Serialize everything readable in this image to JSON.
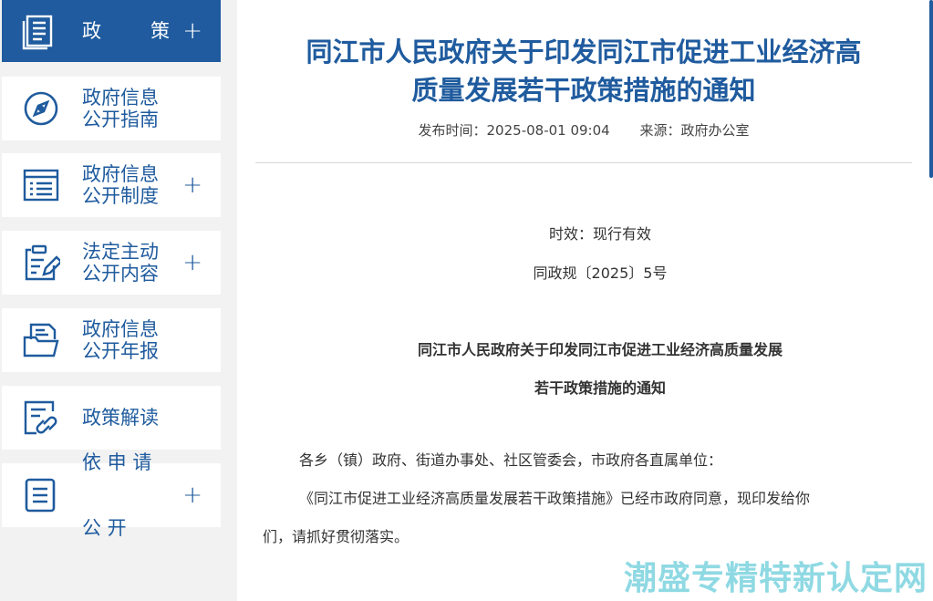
{
  "sidebar": {
    "items": [
      {
        "lines": [
          "政",
          "策"
        ],
        "plus": "+"
      },
      {
        "lines": [
          "政府信息",
          "公开指南"
        ]
      },
      {
        "lines": [
          "政府信息",
          "公开制度"
        ],
        "plus": "+"
      },
      {
        "lines": [
          "法定主动",
          "公开内容"
        ],
        "plus": "+"
      },
      {
        "lines": [
          "政府信息",
          "公开年报"
        ]
      },
      {
        "lines": [
          "政策解读"
        ]
      },
      {
        "lines": [
          "依 申 请",
          "公     开"
        ],
        "plus": "+"
      }
    ]
  },
  "article": {
    "title_line1": "同江市人民政府关于印发同江市促进工业经济高",
    "title_line2": "质量发展若干政策措施的通知",
    "publish_time": "发布时间：2025-08-01 09:04",
    "source": "来源：政府办公室",
    "validity": "时效：现行有效",
    "doc_number": "同政规〔2025〕5号",
    "subtitle_line1": "同江市人民政府关于印发同江市促进工业经济高质量发展",
    "subtitle_line2": "若干政策措施的通知",
    "recipients": "各乡（镇）政府、街道办事处、社区管委会，市政府各直属单位：",
    "body_line1": "《同江市促进工业经济高质量发展若干政策措施》已经市政府同意，现印发给你",
    "body_line2": "们，请抓好贯彻落实。"
  },
  "watermark": "潮盛专精特新认定网",
  "colors": {
    "primary": "#1f5b9e",
    "watermark": "#8fd9e3"
  }
}
